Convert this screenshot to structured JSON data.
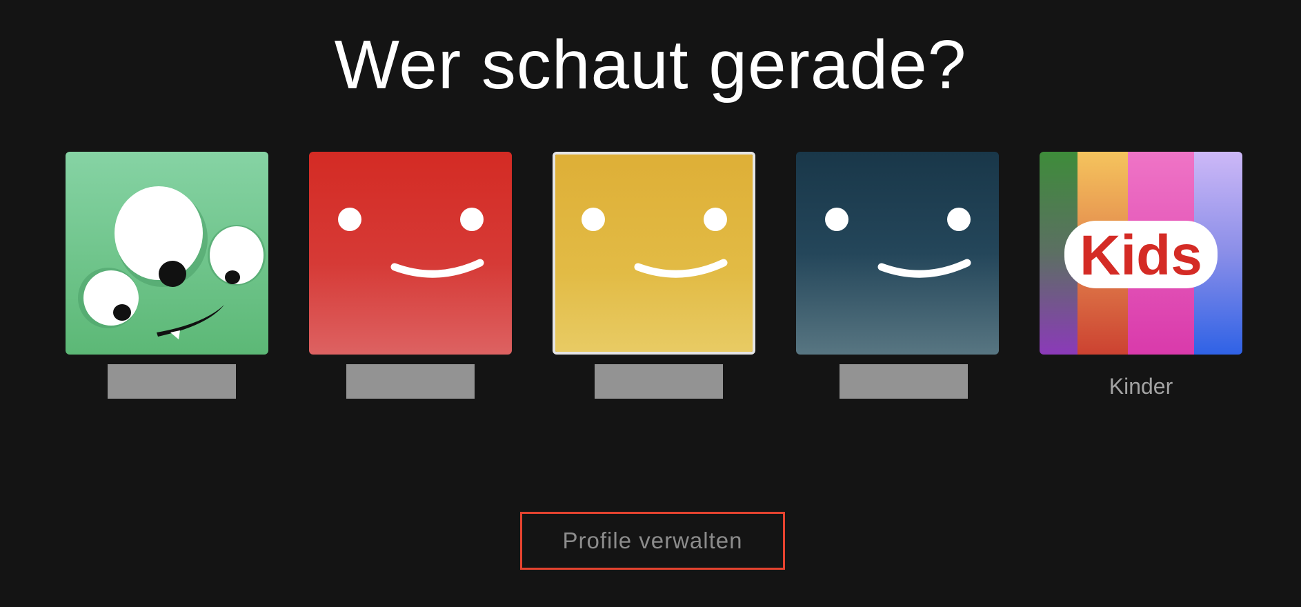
{
  "header": {
    "title": "Wer schaut gerade?"
  },
  "profiles": [
    {
      "name": "",
      "avatar": "green-monster-avatar",
      "color": "#6cc284",
      "selected": false,
      "name_redacted": true
    },
    {
      "name": "",
      "avatar": "red-smiley-avatar",
      "color": "#d52a25",
      "selected": false,
      "name_redacted": true
    },
    {
      "name": "",
      "avatar": "yellow-smiley-avatar",
      "color": "#e1b53c",
      "selected": true,
      "name_redacted": true
    },
    {
      "name": "",
      "avatar": "navy-smiley-avatar",
      "color": "#1b3a4d",
      "selected": false,
      "name_redacted": true
    },
    {
      "name": "Kinder",
      "avatar": "kids-rainbow-avatar",
      "logo_text": "Kids",
      "selected": false,
      "name_redacted": false
    }
  ],
  "actions": {
    "manage_profiles_label": "Profile verwalten"
  },
  "colors": {
    "background": "#141414",
    "manage_border": "#e5432f",
    "name_text": "#a3a3a3"
  }
}
